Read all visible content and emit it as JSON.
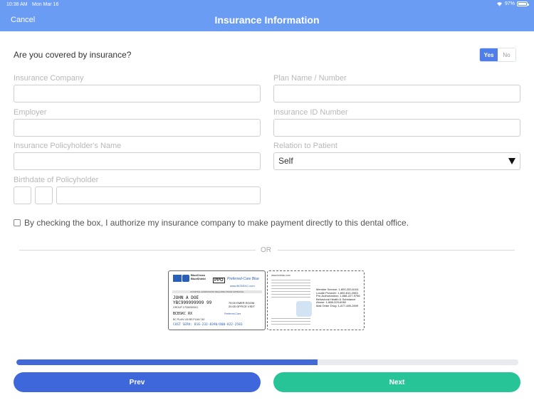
{
  "status_bar": {
    "time": "10:38 AM",
    "date": "Mon Mar 16",
    "battery": "97%",
    "battery_level": 0.97
  },
  "nav": {
    "cancel_label": "Cancel",
    "title": "Insurance Information"
  },
  "coverage": {
    "question": "Are you covered by insurance?",
    "yes_label": "Yes",
    "no_label": "No",
    "selected": "Yes"
  },
  "fields": {
    "insurance_company": {
      "label": "Insurance Company",
      "value": ""
    },
    "plan_name": {
      "label": "Plan Name / Number",
      "value": ""
    },
    "employer": {
      "label": "Employer",
      "value": ""
    },
    "insurance_id": {
      "label": "Insurance ID Number",
      "value": ""
    },
    "policyholder_name": {
      "label": "Insurance Policyholder's Name",
      "value": ""
    },
    "relation": {
      "label": "Relation to Patient",
      "value": "Self"
    },
    "birthdate": {
      "label": "Birthdate of Policyholder",
      "month": "",
      "day": "",
      "year": ""
    }
  },
  "authorize": {
    "label": "By checking the box, I authorize my insurance company to make payment directly to this dental office.",
    "checked": false
  },
  "divider_text": "OR",
  "card_front": {
    "brand": "BlueCross BlueShield",
    "ppo": "PPO",
    "plan": "Preferred-Care Blue",
    "web": "www.BCBSKC.com",
    "strip": "HOSPITAL ADMISSIONS REQUIRE PRIOR APPROVAL",
    "member_name": "JOHN A DOE",
    "member_id": "YBC999999999 99",
    "group": "GROUP 17000000001",
    "rx": "BCBSKC RX",
    "rx_numbers": "BC PLAN 140 BS PLAN 740",
    "service": "CUST SERV: 816-232-8396/800-822-2583",
    "copays": "75.00 EMER ROOM\n20.00 OFFICE VISIT",
    "pc_label": "Preferred Care"
  },
  "card_back": {
    "header": "www.bcbskc.com",
    "contacts": "Member Service: 1-800-253-6161\nLocate Provider: 1-800-810-2583\nPre-Authorization: 1-888-227-9756\nBehavioral Health & Substance\nAbuse: 1-888-329-6060\nMail Order Drug: 1-877-489-2609"
  },
  "progress": {
    "fraction": 0.6
  },
  "buttons": {
    "prev_label": "Prev",
    "next_label": "Next"
  },
  "colors": {
    "header": "#6b9cf3",
    "prev": "#3d67db",
    "next": "#27c497",
    "progress": "#4169d8"
  }
}
